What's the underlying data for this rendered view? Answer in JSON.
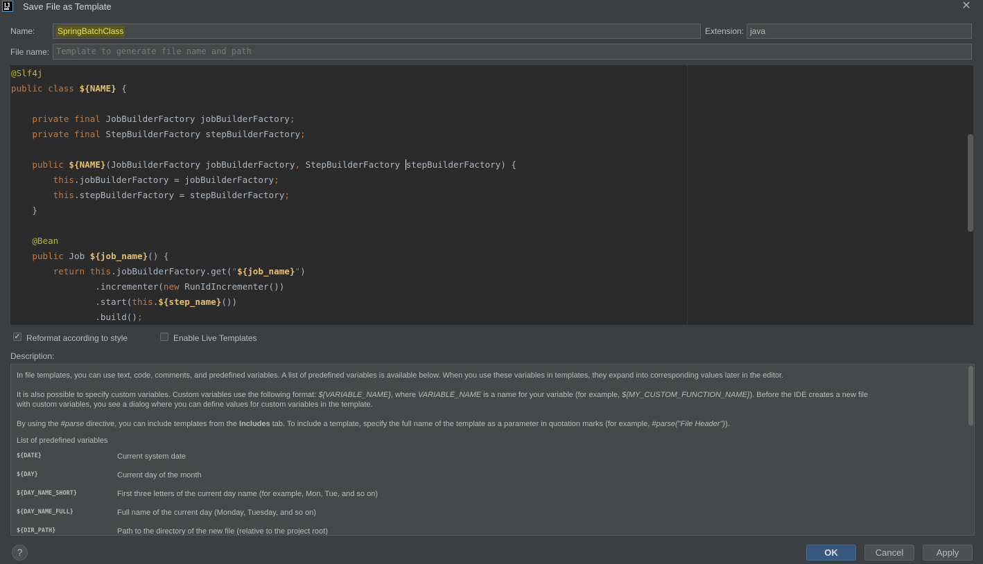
{
  "window": {
    "title": "Save File as Template",
    "close_symbol": "✕",
    "icon_letter": "IJ"
  },
  "form": {
    "name_label": "Name:",
    "name_value": "SpringBatchClass",
    "extension_label": "Extension:",
    "extension_value": "java",
    "filename_label": "File name:",
    "filename_placeholder": "Template to generate file name and path"
  },
  "options": {
    "reformat_label": "Reformat according to style",
    "reformat_checked": true,
    "live_templates_label": "Enable Live Templates",
    "live_templates_checked": false
  },
  "description": {
    "label": "Description:",
    "para1": "In file templates, you can use text, code, comments, and predefined variables. A list of predefined variables is available below. When you use these variables in templates, they expand into corresponding values later in the editor.",
    "para2": {
      "t1": "It is also possible to specify custom variables. Custom variables use the following format: ",
      "e1": "${VARIABLE_NAME}",
      "t2": ", where ",
      "e2": "VARIABLE_NAME",
      "t3": " is a name for your variable (for example, ",
      "e3": "${MY_CUSTOM_FUNCTION_NAME}",
      "t4": "). Before the IDE creates a new file",
      "line2": "with custom variables, you see a dialog where you can define values for custom variables in the template."
    },
    "para3": {
      "t1": "By using the ",
      "e1": "#parse",
      "t2": " directive, you can include templates from the ",
      "b1": "Includes",
      "t3": " tab. To include a template, specify the full name of the template as a parameter in quotation marks (for example, ",
      "e2": "#parse(\"File Header\")",
      "t4": ")."
    },
    "list_title": "List of predefined variables",
    "variables": [
      {
        "name": "${DATE}",
        "desc": "Current system date"
      },
      {
        "name": "${DAY}",
        "desc": "Current day of the month"
      },
      {
        "name": "${DAY_NAME_SHORT}",
        "desc": "First three letters of the current day name (for example, Mon, Tue, and so on)"
      },
      {
        "name": "${DAY_NAME_FULL}",
        "desc": "Full name of the current day (Monday, Tuesday, and so on)"
      },
      {
        "name": "${DIR_PATH}",
        "desc": "Path to the directory of the new file (relative to the project root)"
      }
    ]
  },
  "buttons": {
    "help": "?",
    "ok": "OK",
    "cancel": "Cancel",
    "apply": "Apply"
  },
  "colors": {
    "ok_accent": "#365880",
    "name_highlight": "#5a5a14"
  }
}
